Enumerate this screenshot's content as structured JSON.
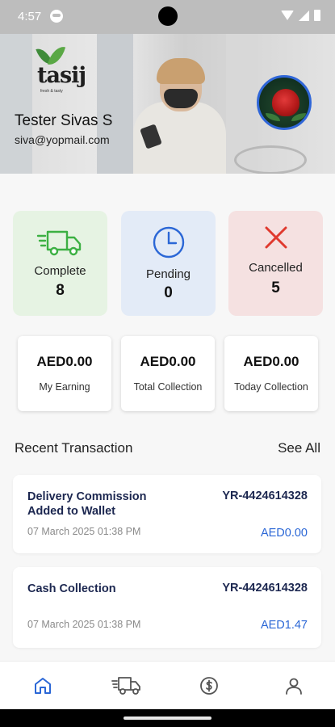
{
  "status_bar": {
    "time": "4:57"
  },
  "profile": {
    "logo_text": "tasij",
    "logo_tagline": "fresh & tasty",
    "name": "Tester Sivas S",
    "email": "siva@yopmail.com",
    "avatar_icon": "rose-avatar"
  },
  "status_cards": [
    {
      "label": "Complete",
      "value": "8",
      "icon": "delivery-truck-icon",
      "color": "#3cb043"
    },
    {
      "label": "Pending",
      "value": "0",
      "icon": "clock-icon",
      "color": "#2b67d6"
    },
    {
      "label": "Cancelled",
      "value": "5",
      "icon": "close-icon",
      "color": "#e03a2f"
    }
  ],
  "earnings": [
    {
      "amount": "AED0.00",
      "label": "My Earning"
    },
    {
      "amount": "AED0.00",
      "label": "Total Collection"
    },
    {
      "amount": "AED0.00",
      "label": "Today Collection"
    }
  ],
  "recent": {
    "title": "Recent Transaction",
    "see_all": "See All",
    "transactions": [
      {
        "title": "Delivery Commission Added to Wallet",
        "id": "YR-4424614328",
        "date": "07 March 2025 01:38 PM",
        "amount": "AED0.00"
      },
      {
        "title": "Cash Collection",
        "id": "YR-4424614328",
        "date": "07 March 2025 01:38 PM",
        "amount": "AED1.47"
      }
    ]
  },
  "bottom_nav": [
    {
      "icon": "home-icon",
      "active": true
    },
    {
      "icon": "delivery-truck-icon",
      "active": false
    },
    {
      "icon": "dollar-icon",
      "active": false
    },
    {
      "icon": "user-icon",
      "active": false
    }
  ],
  "colors": {
    "accent": "#2b67d6",
    "navy_text": "#1c2750"
  }
}
